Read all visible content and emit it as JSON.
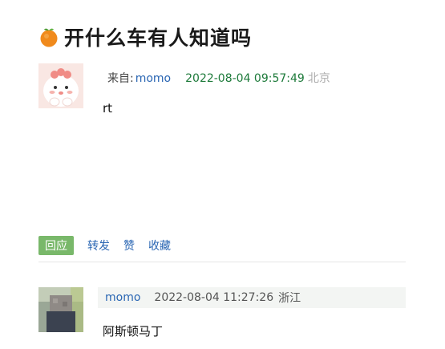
{
  "thread": {
    "title": "开什么车有人知道吗",
    "title_icon": "tangerine-icon"
  },
  "post": {
    "avatar_icon": "cartoon-avatar",
    "from_label": "来自:",
    "username": "momo",
    "timestamp": "2022-08-04 09:57:49",
    "location": "北京",
    "body": "rt"
  },
  "actions": {
    "reply": "回应",
    "repost": "转发",
    "like": "赞",
    "favorite": "收藏"
  },
  "reply": {
    "username": "momo",
    "timestamp": "2022-08-04 11:27:26",
    "location": "浙江",
    "body": "阿斯顿马丁"
  },
  "colors": {
    "link": "#2a66b3",
    "time_green": "#1d7a3a",
    "reply_button": "#79b86a"
  }
}
